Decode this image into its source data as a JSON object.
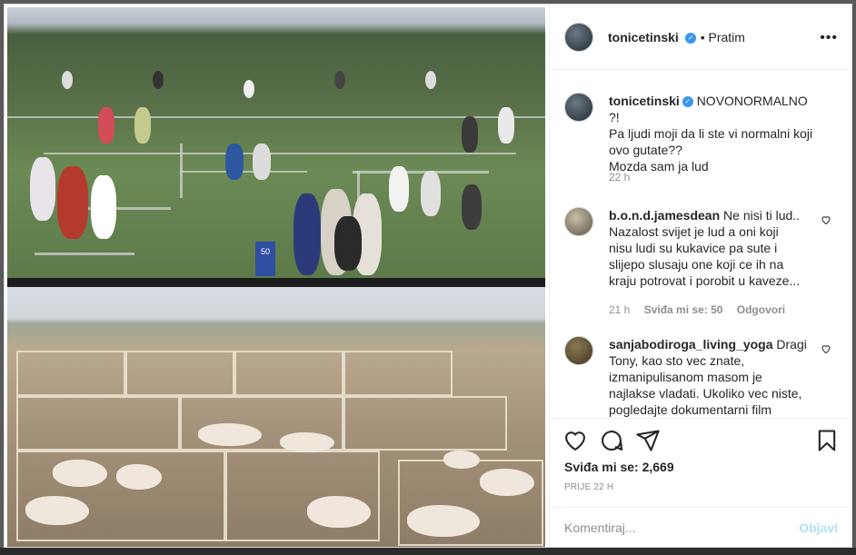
{
  "post": {
    "author": "tonicetinski",
    "follow_status": "• Pratim",
    "caption": {
      "username": "tonicetinski",
      "lines": [
        "NOVONORMALNO ?!",
        "Pa ljudi moji da li ste vi normalni koji",
        "ovo gutate??",
        "Mozda sam ja lud"
      ],
      "time": "22 h"
    }
  },
  "comments": [
    {
      "username": "b.o.n.d.jamesdean",
      "lines": [
        "Ne nisi ti lud..",
        "Nazalost svijet je lud a oni koji",
        "nisu ludi su kukavice pa sute i",
        "slijepo slusaju one koji ce ih na",
        "kraju potrovat i porobit u kaveze..."
      ],
      "time": "21 h",
      "likes": "Sviđa mi se: 50",
      "reply": "Odgovori"
    },
    {
      "username": "sanjabodiroga_living_yoga",
      "lines": [
        "Dragi",
        "Tony, kao sto vec znate,",
        "izmanipulisanom masom je",
        "najlakse vladati. Ukoliko vec niste,",
        "pogledajte dokumentarni film"
      ]
    }
  ],
  "actions": {
    "likes_label": "Sviđa mi se: 2,669",
    "time_caps": "PRIJE 22 H"
  },
  "comment_box": {
    "placeholder": "Komentiraj...",
    "post_label": "Objavi"
  },
  "media": {
    "sign_text": "50"
  },
  "colors": {
    "verified": "#3897f0",
    "post_button": "#b2dffc",
    "muted": "#8e8e8e"
  },
  "icons": [
    "more-icon",
    "verified-icon",
    "heart-icon",
    "comment-icon",
    "share-icon",
    "bookmark-icon"
  ]
}
